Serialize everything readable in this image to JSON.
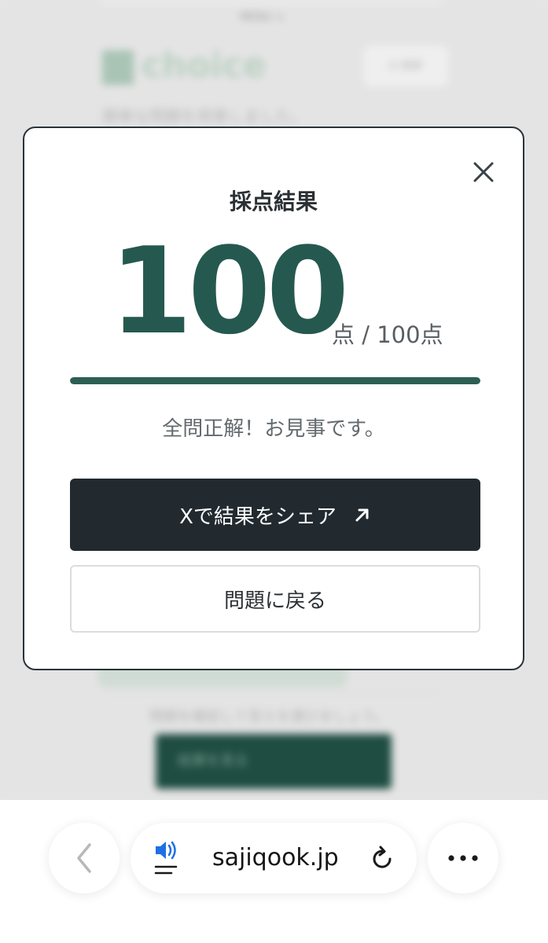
{
  "background_page": {
    "menu": "MENU ∨",
    "logo": "choice",
    "search": "Q 検索",
    "subtitle": "簡単な問題を用意しました。",
    "note": "問題を確認して答えを選びましょう。",
    "submit_button": "結果を見る"
  },
  "modal": {
    "title": "採点結果",
    "score": "100",
    "score_unit": "点 / 100点",
    "score_fraction": 1.0,
    "message": "全問正解！お見事です。",
    "share_button": "Xで結果をシェア",
    "back_button": "問題に戻る"
  },
  "browser": {
    "url": "sajiqook.jp"
  },
  "colors": {
    "accent_green": "#25594f",
    "dark_button": "#222a30"
  },
  "icons": [
    "close-icon",
    "arrow-up-right-icon",
    "chevron-left-icon",
    "speaker-icon",
    "reload-icon",
    "more-icon"
  ]
}
